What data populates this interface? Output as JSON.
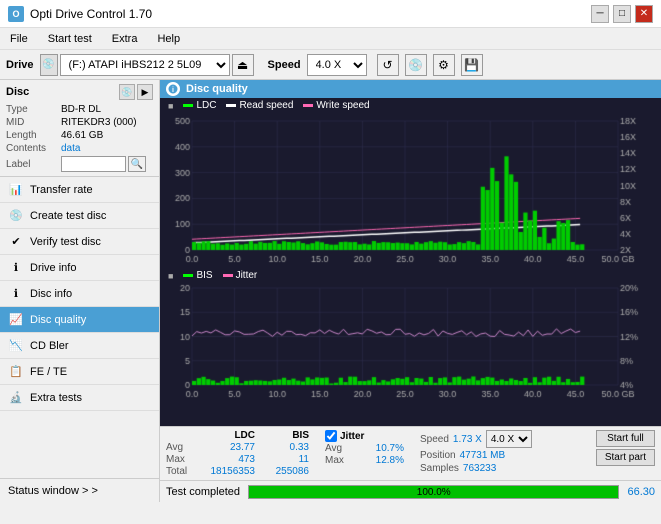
{
  "titlebar": {
    "title": "Opti Drive Control 1.70",
    "icon_label": "O",
    "minimize": "─",
    "maximize": "□",
    "close": "✕"
  },
  "menubar": {
    "items": [
      "File",
      "Start test",
      "Extra",
      "Help"
    ]
  },
  "drivebar": {
    "label": "Drive",
    "drive_value": "(F:)  ATAPI iHBS212  2 5L09",
    "eject_icon": "⏏",
    "speed_label": "Speed",
    "speed_value": "4.0 X",
    "icons": [
      "↺",
      "💿",
      "🔧",
      "💾"
    ]
  },
  "sidebar": {
    "disc_title": "Disc",
    "disc_type_label": "Type",
    "disc_type_value": "BD-R DL",
    "disc_mid_label": "MID",
    "disc_mid_value": "RITEKDR3 (000)",
    "disc_length_label": "Length",
    "disc_length_value": "46.61 GB",
    "disc_contents_label": "Contents",
    "disc_contents_value": "data",
    "disc_label_label": "Label",
    "disc_label_value": "",
    "nav_items": [
      {
        "id": "transfer-rate",
        "label": "Transfer rate",
        "active": false
      },
      {
        "id": "create-test-disc",
        "label": "Create test disc",
        "active": false
      },
      {
        "id": "verify-test-disc",
        "label": "Verify test disc",
        "active": false
      },
      {
        "id": "drive-info",
        "label": "Drive info",
        "active": false
      },
      {
        "id": "disc-info",
        "label": "Disc info",
        "active": false
      },
      {
        "id": "disc-quality",
        "label": "Disc quality",
        "active": true
      },
      {
        "id": "cd-bler",
        "label": "CD Bler",
        "active": false
      },
      {
        "id": "fe-te",
        "label": "FE / TE",
        "active": false
      },
      {
        "id": "extra-tests",
        "label": "Extra tests",
        "active": false
      }
    ],
    "status_window": "Status window > >"
  },
  "chart": {
    "title": "Disc quality",
    "legend_top": [
      {
        "label": "LDC",
        "color": "#00ff00"
      },
      {
        "label": "Read speed",
        "color": "#ffffff"
      },
      {
        "label": "Write speed",
        "color": "#ff69b4"
      }
    ],
    "legend_bottom": [
      {
        "label": "BIS",
        "color": "#00ff00"
      },
      {
        "label": "Jitter",
        "color": "#ff69b4"
      }
    ],
    "top_y_axis": [
      "18X",
      "16X",
      "14X",
      "12X",
      "10X",
      "8X",
      "6X",
      "4X",
      "2X"
    ],
    "top_y_left": [
      "500",
      "400",
      "300",
      "200",
      "100",
      "0"
    ],
    "bottom_y_right": [
      "20%",
      "16%",
      "12%",
      "8%",
      "4%"
    ],
    "x_labels": [
      "0.0",
      "5.0",
      "10.0",
      "15.0",
      "20.0",
      "25.0",
      "30.0",
      "35.0",
      "40.0",
      "45.0",
      "50.0 GB"
    ]
  },
  "stats": {
    "avg_label": "Avg",
    "max_label": "Max",
    "total_label": "Total",
    "ldc_header": "LDC",
    "bis_header": "BIS",
    "jitter_header": "Jitter",
    "ldc_avg": "23.77",
    "bis_avg": "0.33",
    "jitter_avg": "10.7%",
    "ldc_max": "473",
    "bis_max": "11",
    "jitter_max": "12.8%",
    "ldc_total": "18156353",
    "bis_total": "255086",
    "speed_label": "Speed",
    "speed_value": "1.73 X",
    "speed_select": "4.0 X",
    "position_label": "Position",
    "position_value": "47731 MB",
    "samples_label": "Samples",
    "samples_value": "763233",
    "start_full": "Start full",
    "start_part": "Start part"
  },
  "bottombar": {
    "status_text": "Test completed",
    "progress_pct": "100.0%",
    "progress_width": 100,
    "speed_value": "66.30"
  }
}
